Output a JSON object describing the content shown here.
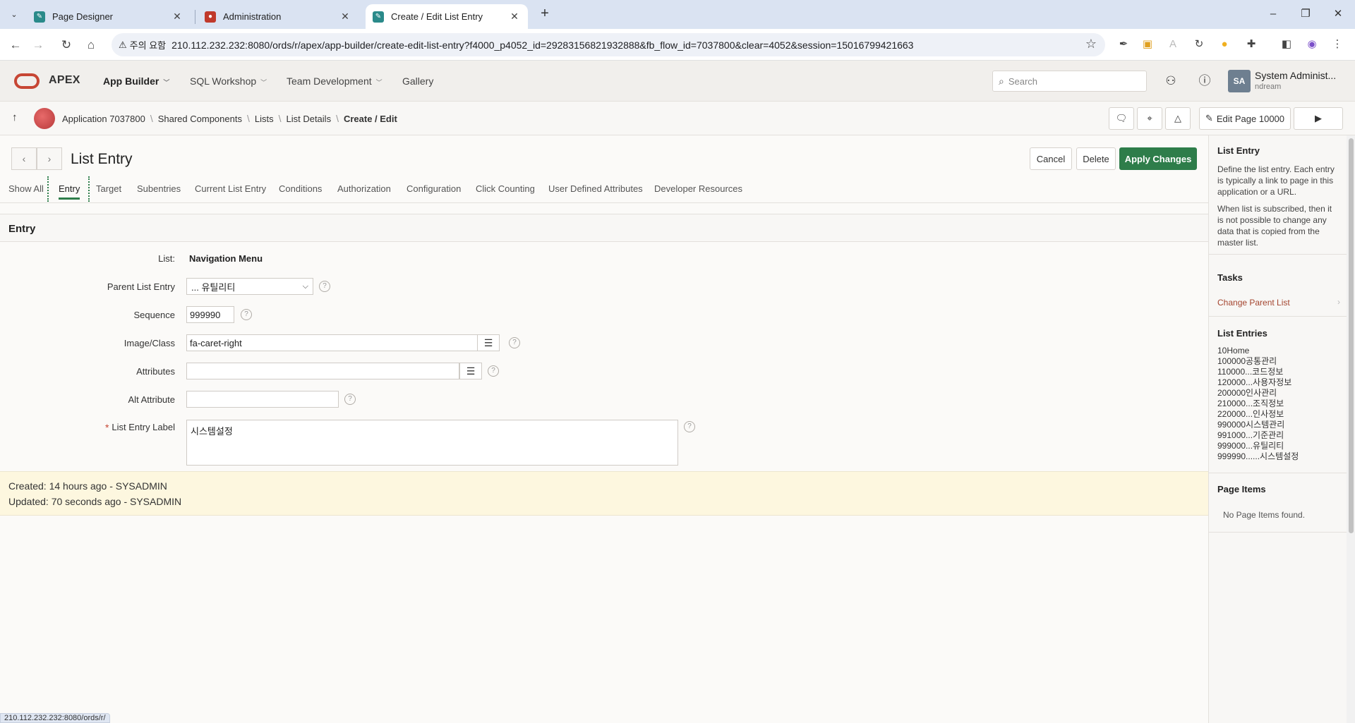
{
  "browser": {
    "tabs": [
      {
        "title": "Page Designer",
        "icon": "page-designer-icon"
      },
      {
        "title": "Administration",
        "icon": "administration-icon"
      },
      {
        "title": "Create / Edit List Entry",
        "icon": "apex-edit-icon"
      }
    ],
    "security_label": "주의 요함",
    "url": "210.112.232.232:8080/ords/r/apex/app-builder/create-edit-list-entry?f4000_p4052_id=29283156821932888&fb_flow_id=7037800&clear=4052&session=15016799421663",
    "status_url": "210.112.232.232:8080/ords/r/"
  },
  "apex": {
    "logo": "APEX",
    "menus": [
      {
        "label": "App Builder"
      },
      {
        "label": "SQL Workshop"
      },
      {
        "label": "Team Development"
      },
      {
        "label": "Gallery"
      }
    ],
    "search_placeholder": "Search",
    "user": {
      "initials": "SA",
      "name": "System Administ...",
      "sub": "ndream"
    }
  },
  "breadcrumbs": {
    "items": [
      "Application 7037800",
      "Shared Components",
      "Lists",
      "List Details",
      "Create / Edit"
    ],
    "edit_page_label": "Edit Page 10000"
  },
  "page": {
    "title": "List Entry",
    "buttons": {
      "cancel": "Cancel",
      "delete": "Delete",
      "apply": "Apply Changes"
    },
    "tabs": [
      "Show All",
      "Entry",
      "Target",
      "Subentries",
      "Current List Entry",
      "Conditions",
      "Authorization",
      "Configuration",
      "Click Counting",
      "User Defined Attributes",
      "Developer Resources"
    ],
    "active_tab": "Entry",
    "region_title": "Entry",
    "form": {
      "list_label": "List:",
      "list_value": "Navigation Menu",
      "parent_label": "Parent List Entry",
      "parent_value": "... 유틸리티",
      "sequence_label": "Sequence",
      "sequence_value": "999990",
      "image_label": "Image/Class",
      "image_value": "fa-caret-right",
      "attributes_label": "Attributes",
      "attributes_value": "",
      "alt_label": "Alt Attribute",
      "alt_value": "",
      "entry_label_label": "List Entry Label",
      "entry_label_value": "시스템설정"
    },
    "audit": {
      "created": "Created: 14 hours ago - SYSADMIN",
      "updated": "Updated: 70 seconds ago - SYSADMIN"
    }
  },
  "sidebar": {
    "help_title": "List Entry",
    "help_p1": "Define the list entry. Each entry is typically a link to page in this application or a URL.",
    "help_p2": "When list is subscribed, then it is not possible to change any data that is copied from the master list.",
    "tasks_title": "Tasks",
    "task_link": "Change Parent List",
    "entries_title": "List Entries",
    "entries": [
      "10Home",
      "100000공통관리",
      "110000...코드정보",
      "120000...사용자정보",
      "200000인사관리",
      "210000...조직정보",
      "220000...인사정보",
      "990000시스템관리",
      "991000...기준관리",
      "999000...유틸리티",
      "999990......시스템설정"
    ],
    "page_items_title": "Page Items",
    "page_items_empty": "No Page Items found."
  },
  "colors": {
    "primary": "#2e7d4a",
    "brand": "#c74634",
    "link": "#a4452f"
  }
}
